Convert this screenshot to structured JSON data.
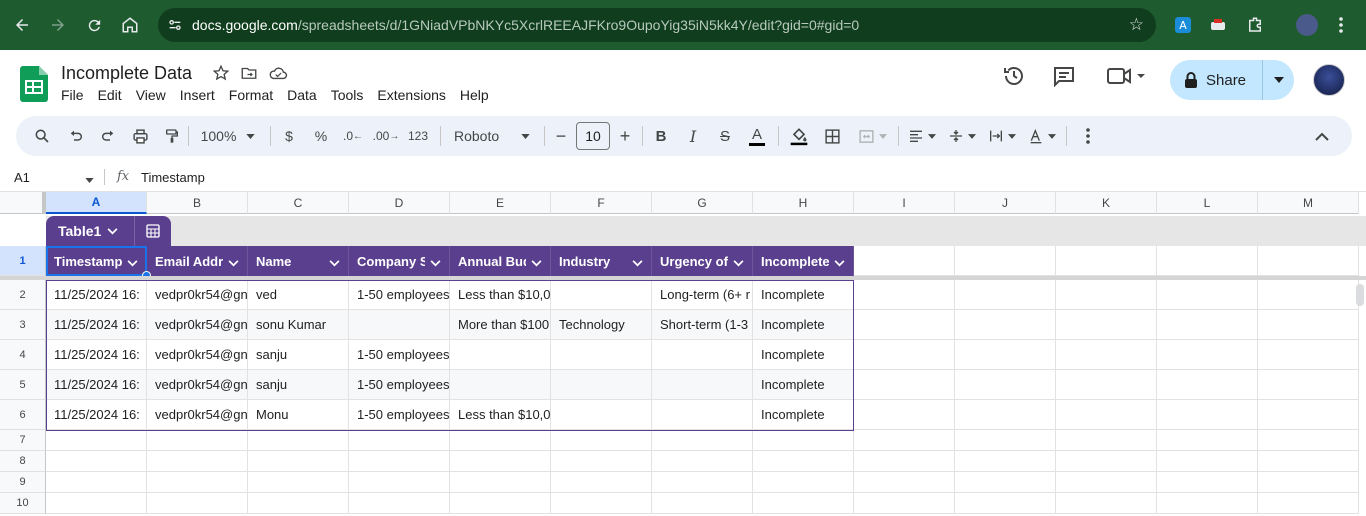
{
  "browser": {
    "url_host": "docs.google.com",
    "url_path": "/spreadsheets/d/1GNiadVPbNKYc5XcrlREEAJFKro9OupoYig35iN5kk4Y/edit?gid=0#gid=0"
  },
  "doc": {
    "title": "Incomplete Data",
    "menu": [
      "File",
      "Edit",
      "View",
      "Insert",
      "Format",
      "Data",
      "Tools",
      "Extensions",
      "Help"
    ],
    "share_label": "Share"
  },
  "toolbar": {
    "zoom": "100%",
    "currency": "$",
    "percent": "%",
    "dec_decrease": ".0",
    "dec_increase": ".00",
    "number_format": "123",
    "font": "Roboto",
    "font_size": "10",
    "bold": "B",
    "italic": "I",
    "strike": "S",
    "text_color": "A"
  },
  "formula_bar": {
    "name_box": "A1",
    "fx": "fx",
    "value": "Timestamp"
  },
  "grid": {
    "columns": [
      "A",
      "B",
      "C",
      "D",
      "E",
      "F",
      "G",
      "H",
      "I",
      "J",
      "K",
      "L",
      "M"
    ],
    "rows": [
      "1",
      "2",
      "3",
      "4",
      "5",
      "6",
      "7",
      "8",
      "9",
      "10"
    ],
    "table_name": "Table1",
    "headers": [
      "Timestamp",
      "Email Addre",
      "Name",
      "Company S",
      "Annual Bud",
      "Industry",
      "Urgency of",
      "Incomplete"
    ],
    "data": [
      [
        "11/25/2024 16:",
        "vedpr0kr54@gn",
        "ved",
        "1-50 employees",
        "Less than $10,0",
        "",
        "Long-term (6+ r",
        "Incomplete"
      ],
      [
        "11/25/2024 16:",
        "vedpr0kr54@gn",
        "sonu Kumar",
        "",
        "More than $100",
        "Technology",
        "Short-term (1-3",
        "Incomplete"
      ],
      [
        "11/25/2024 16:",
        "vedpr0kr54@gn",
        "sanju",
        "1-50 employees",
        "",
        "",
        "",
        "Incomplete"
      ],
      [
        "11/25/2024 16:",
        "vedpr0kr54@gn",
        "sanju",
        "1-50 employees",
        "",
        "",
        "",
        "Incomplete"
      ],
      [
        "11/25/2024 16:",
        "vedpr0kr54@gn",
        "Monu",
        "1-50 employees",
        "Less than $10,0",
        "",
        "",
        "Incomplete"
      ]
    ]
  },
  "colors": {
    "chrome": "#1e5b2e",
    "table_header": "#5b3f8f",
    "selection": "#1a73e8",
    "share_bg": "#c2e7ff"
  }
}
